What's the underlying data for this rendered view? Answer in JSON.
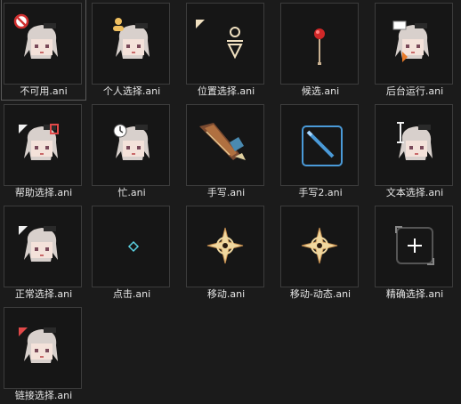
{
  "files": [
    {
      "name": "不可用.ani",
      "icon": "unavailable-cursor-icon"
    },
    {
      "name": "个人选择.ani",
      "icon": "person-select-cursor-icon"
    },
    {
      "name": "位置选择.ani",
      "icon": "location-select-cursor-icon"
    },
    {
      "name": "候选.ani",
      "icon": "alternate-select-cursor-icon"
    },
    {
      "name": "后台运行.ani",
      "icon": "working-in-background-cursor-icon"
    },
    {
      "name": "帮助选择.ani",
      "icon": "help-select-cursor-icon"
    },
    {
      "name": "忙.ani",
      "icon": "busy-cursor-icon"
    },
    {
      "name": "手写.ani",
      "icon": "handwriting-cursor-icon"
    },
    {
      "name": "手写2.ani",
      "icon": "handwriting-2-cursor-icon"
    },
    {
      "name": "文本选择.ani",
      "icon": "text-select-cursor-icon"
    },
    {
      "name": "正常选择.ani",
      "icon": "normal-select-cursor-icon"
    },
    {
      "name": "点击.ani",
      "icon": "click-cursor-icon"
    },
    {
      "name": "移动.ani",
      "icon": "move-cursor-icon"
    },
    {
      "name": "移动-动态.ani",
      "icon": "move-animated-cursor-icon"
    },
    {
      "name": "精确选择.ani",
      "icon": "precision-select-cursor-icon"
    },
    {
      "name": "链接选择.ani",
      "icon": "link-select-cursor-icon"
    }
  ],
  "selected_index": 0
}
